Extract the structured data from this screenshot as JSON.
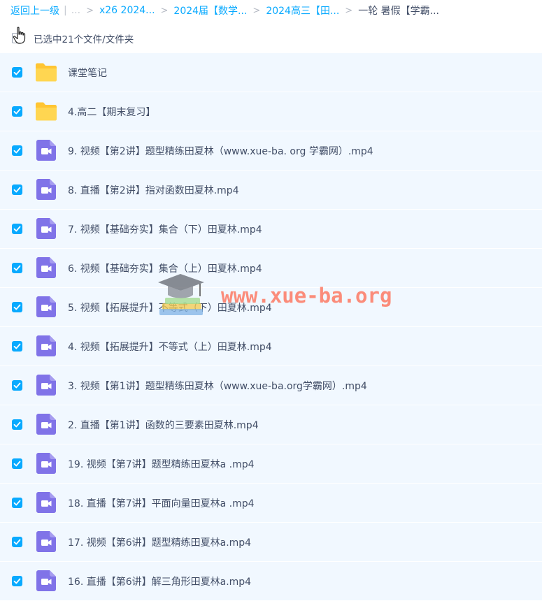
{
  "breadcrumb": {
    "back": "返回上一级",
    "separator_bar": "|",
    "ellipsis": "...",
    "links": [
      "x26 2024...",
      "2024届【数学...",
      "2024高三【田..."
    ],
    "current": "一轮 暑假【学霸..."
  },
  "selection": {
    "text": "已选中21个文件/文件夹"
  },
  "files": [
    {
      "name": "课堂笔记",
      "icon": "folder-icon",
      "checked": true
    },
    {
      "name": "4.高二【期末复习】",
      "icon": "folder-icon",
      "checked": true
    },
    {
      "name": "9. 视频【第2讲】题型精练田夏林（www.xue-ba. org 学霸网）.mp4",
      "icon": "video-file-icon",
      "checked": true
    },
    {
      "name": "8. 直播【第2讲】指对函数田夏林.mp4",
      "icon": "video-file-icon",
      "checked": true
    },
    {
      "name": "7. 视频【基础夯实】集合（下）田夏林.mp4",
      "icon": "video-file-icon",
      "checked": true
    },
    {
      "name": "6. 视频【基础夯实】集合（上）田夏林.mp4",
      "icon": "video-file-icon",
      "checked": true
    },
    {
      "name": "5. 视频【拓展提升】不等式（下）田夏林.mp4",
      "icon": "video-file-icon",
      "checked": true
    },
    {
      "name": "4. 视频【拓展提升】不等式（上）田夏林.mp4",
      "icon": "video-file-icon",
      "checked": true
    },
    {
      "name": "3. 视频【第1讲】题型精练田夏林（www.xue-ba.org学霸网）.mp4",
      "icon": "video-file-icon",
      "checked": true
    },
    {
      "name": "2. 直播【第1讲】函数的三要素田夏林.mp4",
      "icon": "video-file-icon",
      "checked": true
    },
    {
      "name": "19. 视频【第7讲】题型精练田夏林a .mp4",
      "icon": "video-file-icon",
      "checked": true
    },
    {
      "name": "18. 直播【第7讲】平面向量田夏林a .mp4",
      "icon": "video-file-icon",
      "checked": true
    },
    {
      "name": "17. 视频【第6讲】题型精练田夏林a.mp4",
      "icon": "video-file-icon",
      "checked": true
    },
    {
      "name": "16. 直播【第6讲】解三角形田夏林a.mp4",
      "icon": "video-file-icon",
      "checked": true
    }
  ],
  "watermark": {
    "text": "www.xue-ba.org"
  },
  "colors": {
    "accent": "#09aaff",
    "row_bg": "#f1f8ff",
    "folder": "#ffd04b",
    "video_icon": "#8073e8",
    "watermark": "#ff6347"
  }
}
